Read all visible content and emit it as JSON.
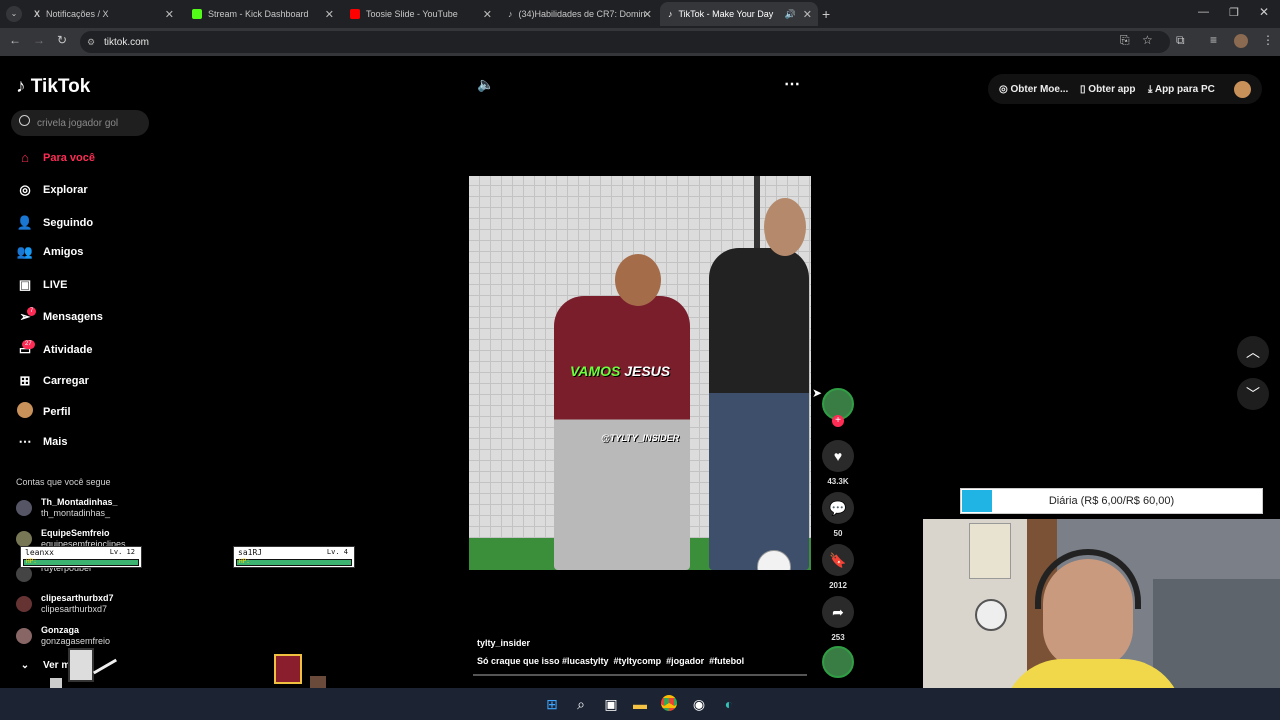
{
  "browser": {
    "tabs": [
      {
        "title": "Notificações / X",
        "color": "#ffffff"
      },
      {
        "title": "Stream - Kick Dashboard",
        "color": "#53fc18"
      },
      {
        "title": "Toosie Slide - YouTube",
        "color": "#ff0000"
      },
      {
        "title": "(34)Habilidades de CR7: Domin",
        "color": "#ffffff"
      },
      {
        "title": "TikTok - Make Your Day",
        "color": "#ffffff"
      }
    ],
    "url": "tiktok.com"
  },
  "tiktok": {
    "logo": "TikTok",
    "search_placeholder": "crivela jogador gol",
    "nav": [
      {
        "label": "Para você",
        "icon": "home-icon"
      },
      {
        "label": "Explorar",
        "icon": "compass-icon"
      },
      {
        "label": "Seguindo",
        "icon": "user-follow-icon"
      },
      {
        "label": "Amigos",
        "icon": "friends-icon"
      },
      {
        "label": "LIVE",
        "icon": "live-icon"
      },
      {
        "label": "Mensagens",
        "icon": "send-icon",
        "badge": "7"
      },
      {
        "label": "Atividade",
        "icon": "activity-icon",
        "badge": "27"
      },
      {
        "label": "Carregar",
        "icon": "upload-icon"
      },
      {
        "label": "Perfil",
        "icon": "avatar-icon"
      },
      {
        "label": "Mais",
        "icon": "more-icon"
      }
    ],
    "following_title": "Contas que você segue",
    "accounts": [
      {
        "name": "Th_Montadinhas_",
        "handle": "th_montadinhas_"
      },
      {
        "name": "EquipeSemfreio",
        "handle": "equipesemfreioclipes"
      },
      {
        "name": "",
        "handle": "ruyterpoubel"
      },
      {
        "name": "clipesarthurbxd7",
        "handle": "clipesarthurbxd7"
      },
      {
        "name": "Gonzaga",
        "handle": "gonzagasemfreio"
      }
    ],
    "see_more": "Ver m",
    "top_right": {
      "coins": "Obter Moe...",
      "app": "Obter app",
      "pc": "App para PC"
    },
    "video": {
      "caption_green": "VAMOS",
      "caption_white": "JESUS",
      "watermark": "@TYLTY_INSIDER",
      "author": "tylty_insider",
      "description": "Só craque que isso #lucastylty  #tyltycomp  #jogador  #futebol"
    },
    "actions": {
      "likes": "43.3K",
      "comments": "50",
      "saves": "2012",
      "shares": "253"
    }
  },
  "overlay": {
    "players": [
      {
        "name": "leanxx",
        "level": "Lv. 12",
        "hp": "HP:"
      },
      {
        "name": "sa1RJ",
        "level": "Lv. 4",
        "hp": "HP:"
      }
    ],
    "goal": {
      "label": "Diária (R$ 6,00/R$ 60,00)",
      "progress": 0.1
    }
  }
}
